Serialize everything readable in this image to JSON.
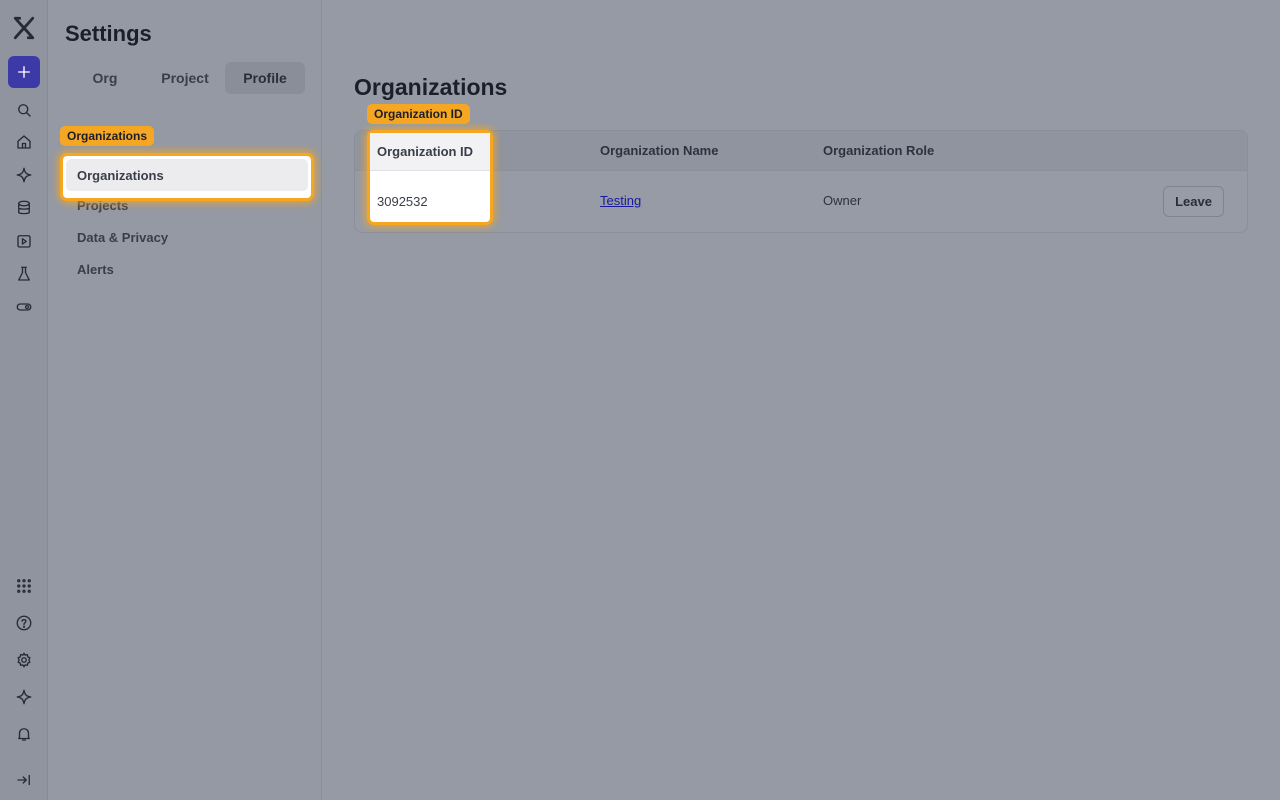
{
  "rail": {
    "icons": [
      "logo-x-icon",
      "plus-icon",
      "search-icon",
      "home-icon",
      "sparkle-icon",
      "database-icon",
      "play-icon",
      "flask-icon",
      "toggle-icon",
      "grid-icon",
      "help-icon",
      "gear-icon",
      "sparkle-icon",
      "bell-icon",
      "collapse-icon"
    ],
    "accent": "#3d3aa8"
  },
  "sidebar": {
    "title": "Settings",
    "tabs": [
      {
        "label": "Org"
      },
      {
        "label": "Project"
      },
      {
        "label": "Profile",
        "active": true
      }
    ],
    "section_tag": "Organizations",
    "items": [
      {
        "label": "Organizations",
        "active": true
      },
      {
        "label": "Projects"
      },
      {
        "label": "Data & Privacy"
      },
      {
        "label": "Alerts"
      }
    ]
  },
  "main": {
    "title": "Organizations",
    "column_tag": "Organization ID",
    "columns": [
      "Organization ID",
      "Organization Name",
      "Organization Role"
    ],
    "rows": [
      {
        "id": "3092532",
        "name": "Testing",
        "role": "Owner",
        "action": "Leave"
      }
    ]
  },
  "highlight_color": "#f5a623"
}
